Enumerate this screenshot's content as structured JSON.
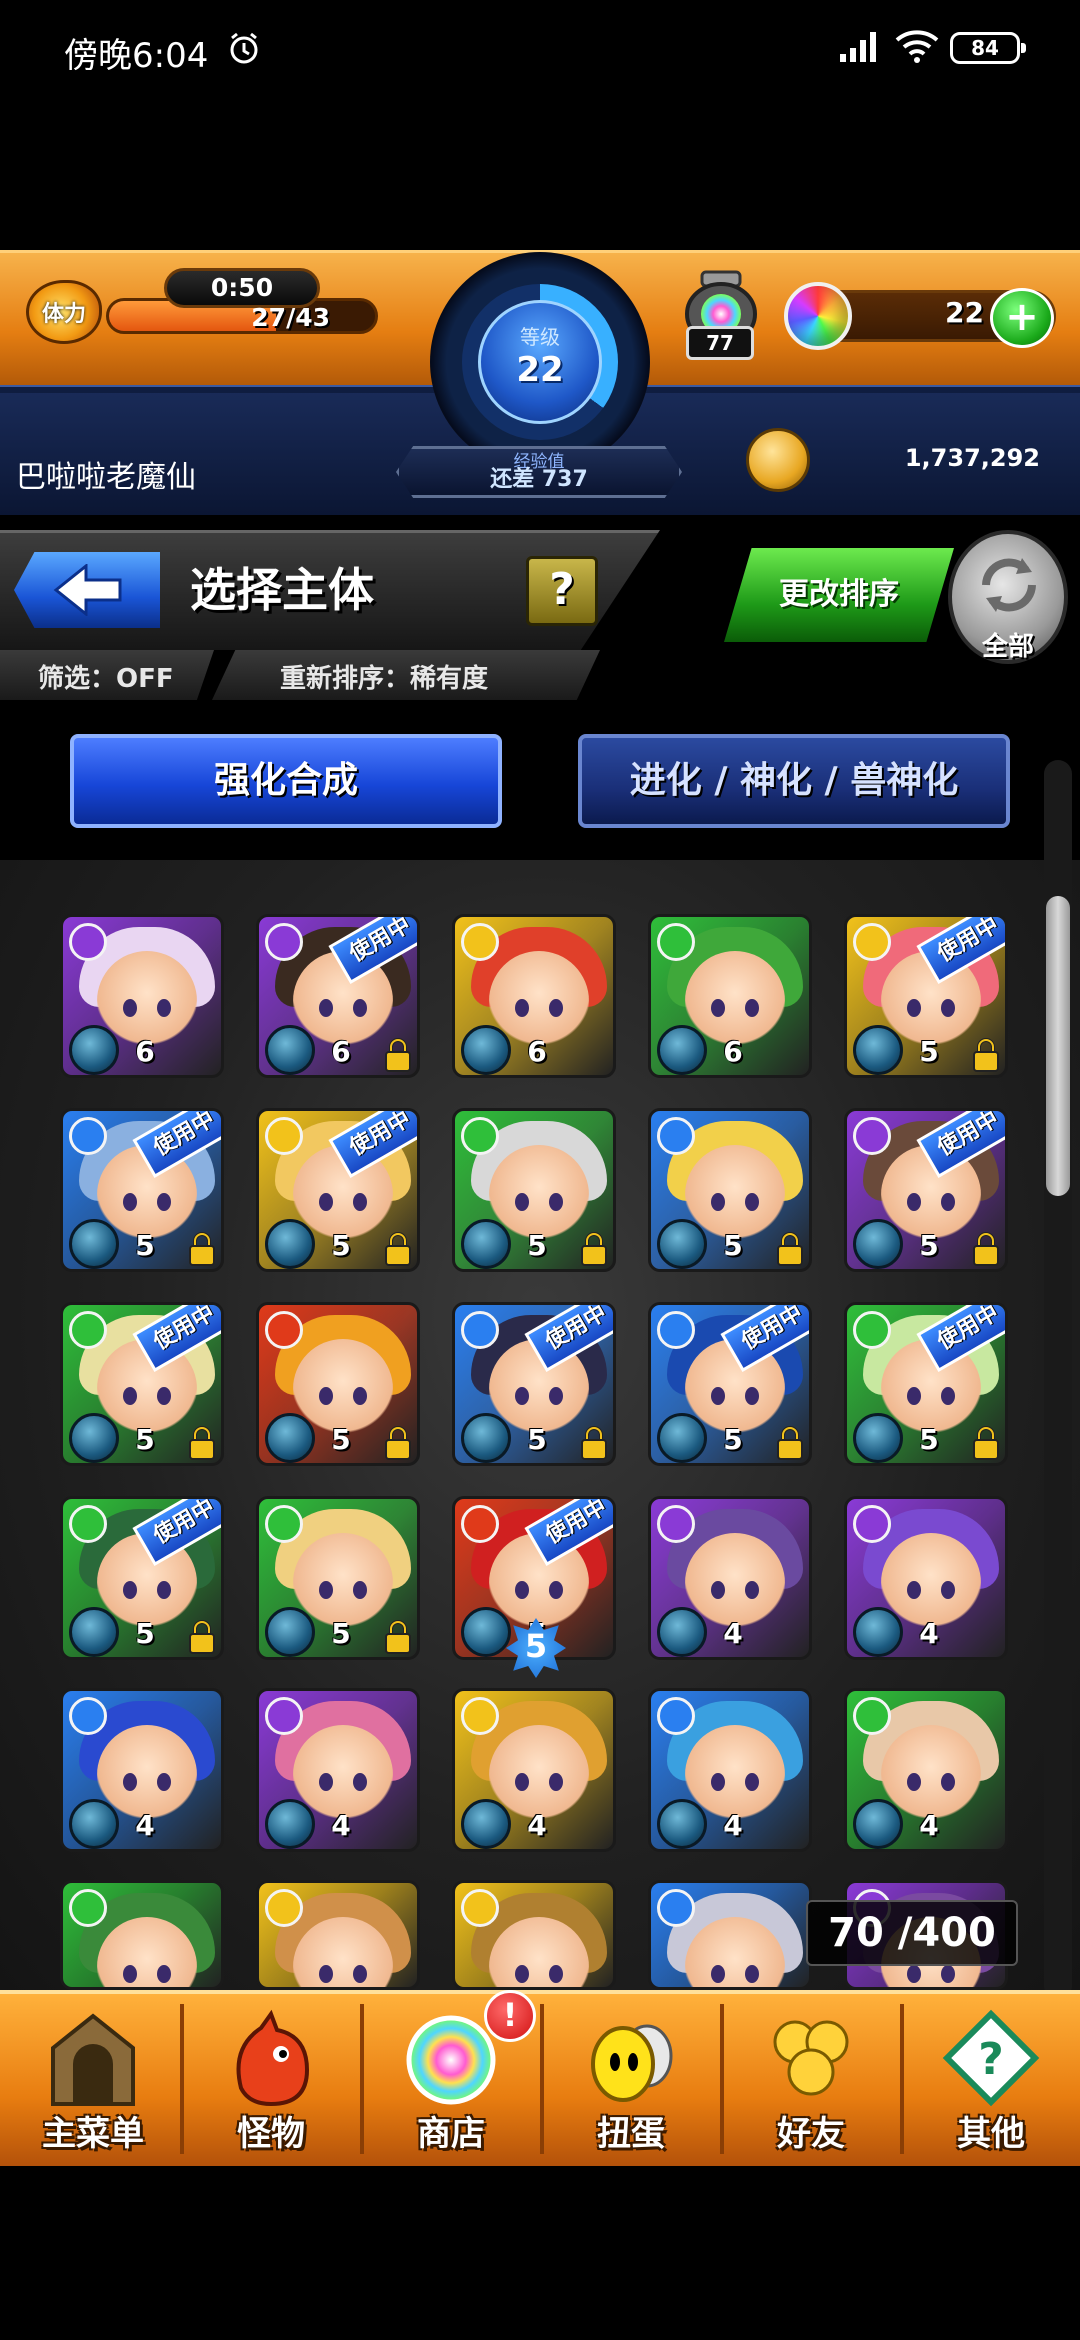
{
  "status_bar": {
    "time": "傍晚6:04",
    "battery": "84"
  },
  "header": {
    "stamina_label": "体力",
    "stamina_timer": "0:50",
    "stamina_value": "27/43",
    "stamina_fraction": 0.628,
    "level_label": "等级",
    "level": "22",
    "exp_label": "经验值",
    "exp_remaining": "还差 737",
    "egg_count": "77",
    "orb_count": "22",
    "player_name": "巴啦啦老魔仙",
    "gold": "1,737,292"
  },
  "toolbar": {
    "title": "选择主体",
    "help": "?",
    "filter": "筛选：OFF",
    "sort": "重新排序：稀有度",
    "change_sort": "更改排序",
    "all": "全部"
  },
  "tabs": [
    "强化合成",
    "进化 / 神化 / 兽神化"
  ],
  "in_use_label": "使用中",
  "monsters": [
    {
      "element": "dark",
      "rank": "6",
      "in_use": false,
      "locked": false
    },
    {
      "element": "dark",
      "rank": "6",
      "in_use": true,
      "locked": true
    },
    {
      "element": "light",
      "rank": "6",
      "in_use": false,
      "locked": false
    },
    {
      "element": "wood",
      "rank": "6",
      "in_use": false,
      "locked": false
    },
    {
      "element": "light",
      "rank": "5",
      "in_use": true,
      "locked": true
    },
    {
      "element": "water",
      "rank": "5",
      "in_use": true,
      "locked": true
    },
    {
      "element": "light",
      "rank": "5",
      "in_use": true,
      "locked": true
    },
    {
      "element": "wood",
      "rank": "5",
      "in_use": false,
      "locked": true
    },
    {
      "element": "water",
      "rank": "5",
      "in_use": false,
      "locked": true
    },
    {
      "element": "dark",
      "rank": "5",
      "in_use": true,
      "locked": true
    },
    {
      "element": "wood",
      "rank": "5",
      "in_use": true,
      "locked": true
    },
    {
      "element": "fire",
      "rank": "5",
      "in_use": false,
      "locked": true
    },
    {
      "element": "water",
      "rank": "5",
      "in_use": true,
      "locked": true
    },
    {
      "element": "water",
      "rank": "5",
      "in_use": true,
      "locked": true
    },
    {
      "element": "wood",
      "rank": "5",
      "in_use": true,
      "locked": true
    },
    {
      "element": "wood",
      "rank": "5",
      "in_use": true,
      "locked": true
    },
    {
      "element": "wood",
      "rank": "5",
      "in_use": false,
      "locked": true
    },
    {
      "element": "fire",
      "rank": "5",
      "in_use": true,
      "locked": false
    },
    {
      "element": "dark",
      "rank": "4",
      "in_use": false,
      "locked": false
    },
    {
      "element": "dark",
      "rank": "4",
      "in_use": false,
      "locked": false
    },
    {
      "element": "water",
      "rank": "4",
      "in_use": false,
      "locked": false
    },
    {
      "element": "dark",
      "rank": "4",
      "in_use": false,
      "locked": false
    },
    {
      "element": "light",
      "rank": "4",
      "in_use": false,
      "locked": false
    },
    {
      "element": "water",
      "rank": "4",
      "in_use": false,
      "locked": false
    },
    {
      "element": "wood",
      "rank": "4",
      "in_use": false,
      "locked": false
    },
    {
      "element": "wood",
      "rank": "",
      "in_use": false,
      "locked": false
    },
    {
      "element": "light",
      "rank": "",
      "in_use": false,
      "locked": false
    },
    {
      "element": "light",
      "rank": "",
      "in_use": false,
      "locked": false
    },
    {
      "element": "water",
      "rank": "",
      "in_use": false,
      "locked": false
    },
    {
      "element": "dark",
      "rank": "",
      "in_use": false,
      "locked": false
    }
  ],
  "box_count": "70 /400",
  "nav": [
    {
      "label": "主菜单",
      "icon": "castle-gate-icon"
    },
    {
      "label": "怪物",
      "icon": "dragon-icon"
    },
    {
      "label": "商店",
      "icon": "rainbow-orb-icon"
    },
    {
      "label": "扭蛋",
      "icon": "egg-icon"
    },
    {
      "label": "好友",
      "icon": "friends-balloon-icon"
    },
    {
      "label": "其他",
      "icon": "question-tag-icon"
    }
  ],
  "shop_badge": "!",
  "colors": {
    "fire": "#e03a1a",
    "water": "#2a7ff0",
    "wood": "#2fbf3a",
    "light": "#f2c21b",
    "dark": "#8a3ad6"
  }
}
